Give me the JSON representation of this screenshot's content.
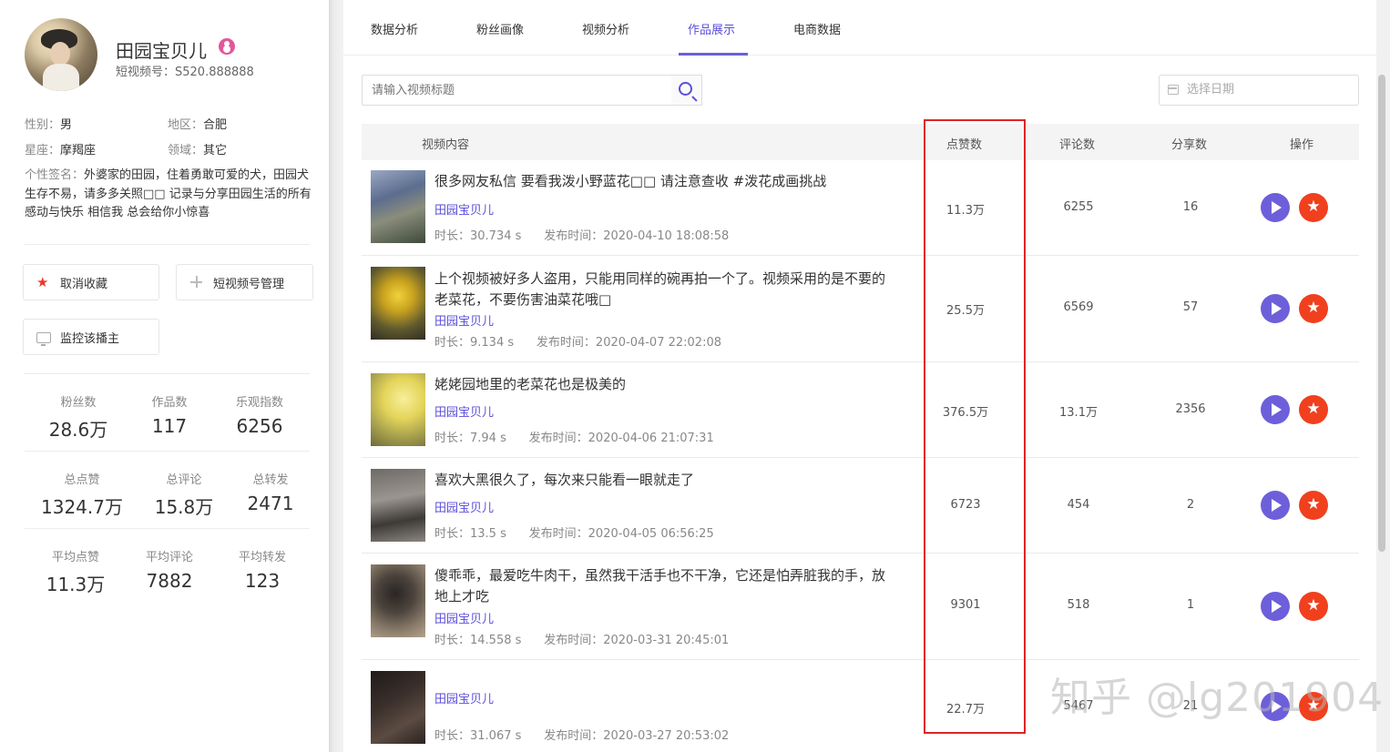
{
  "profile": {
    "name": "田园宝贝儿",
    "video_id": "短视频号：S520.888888",
    "gender_label": "性别：",
    "gender": "男",
    "region_label": "地区：",
    "region": "合肥",
    "zodiac_label": "星座：",
    "zodiac": "摩羯座",
    "field_label": "领域：",
    "field": "其它",
    "signature_label": "个性签名：",
    "signature": "外婆家的田园，住着勇敢可爱的犬，田园犬生存不易，请多多关照□□ 记录与分享田园生活的所有感动与快乐 相信我 总会给你小惊喜"
  },
  "actions": {
    "unfavorite": "取消收藏",
    "manage": "短视频号管理",
    "monitor": "监控该播主"
  },
  "stats": [
    {
      "label": "粉丝数",
      "value": "28.6万"
    },
    {
      "label": "作品数",
      "value": "117"
    },
    {
      "label": "乐观指数",
      "value": "6256"
    },
    {
      "label": "总点赞",
      "value": "1324.7万"
    },
    {
      "label": "总评论",
      "value": "15.8万"
    },
    {
      "label": "总转发",
      "value": "2471"
    },
    {
      "label": "平均点赞",
      "value": "11.3万"
    },
    {
      "label": "平均评论",
      "value": "7882"
    },
    {
      "label": "平均转发",
      "value": "123"
    }
  ],
  "tabs": [
    "数据分析",
    "粉丝画像",
    "视频分析",
    "作品展示",
    "电商数据"
  ],
  "active_tab": "作品展示",
  "search": {
    "placeholder": "请输入视频标题"
  },
  "date": {
    "placeholder": "选择日期"
  },
  "columns": [
    "视频内容",
    "点赞数",
    "评论数",
    "分享数",
    "操作"
  ],
  "rows": [
    {
      "title": "很多网友私信 要看我泼小野蓝花□□ 请注意查收 #泼花成画挑战",
      "author": "田园宝贝儿",
      "duration": "时长：30.734 s",
      "published": "发布时间：2020-04-10 18:08:58",
      "likes": "11.3万",
      "comments": "6255",
      "shares": "16"
    },
    {
      "title": "上个视频被好多人盗用，只能用同样的碗再拍一个了。视频采用的是不要的老菜花，不要伤害油菜花哦□",
      "author": "田园宝贝儿",
      "duration": "时长：9.134 s",
      "published": "发布时间：2020-04-07 22:02:08",
      "likes": "25.5万",
      "comments": "6569",
      "shares": "57"
    },
    {
      "title": "姥姥园地里的老菜花也是极美的",
      "author": "田园宝贝儿",
      "duration": "时长：7.94 s",
      "published": "发布时间：2020-04-06 21:07:31",
      "likes": "376.5万",
      "comments": "13.1万",
      "shares": "2356"
    },
    {
      "title": "喜欢大黑很久了，每次来只能看一眼就走了",
      "author": "田园宝贝儿",
      "duration": "时长：13.5 s",
      "published": "发布时间：2020-04-05 06:56:25",
      "likes": "6723",
      "comments": "454",
      "shares": "2"
    },
    {
      "title": "傻乖乖，最爱吃牛肉干，虽然我干活手也不干净，它还是怕弄脏我的手，放地上才吃",
      "author": "田园宝贝儿",
      "duration": "时长：14.558 s",
      "published": "发布时间：2020-03-31 20:45:01",
      "likes": "9301",
      "comments": "518",
      "shares": "1"
    },
    {
      "title": "",
      "author": "田园宝贝儿",
      "duration": "时长：31.067 s",
      "published": "发布时间：2020-03-27 20:53:02",
      "likes": "22.7万",
      "comments": "5467",
      "shares": "21"
    }
  ],
  "watermark": "知乎 @lg201904",
  "colors": {
    "accent": "#5b4fd9",
    "play": "#6d5fd9",
    "favorite": "#f0401e",
    "highlight_box": "#e02424"
  }
}
